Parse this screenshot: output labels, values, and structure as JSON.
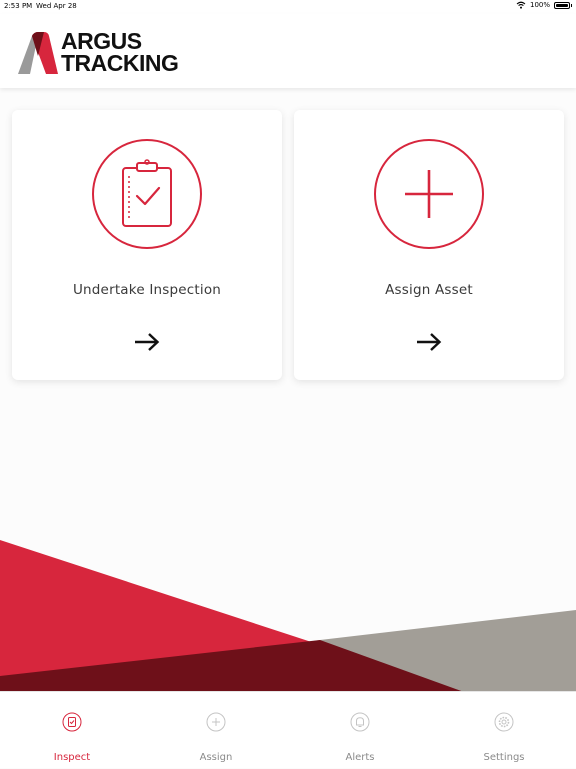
{
  "status_bar": {
    "time": "2:53 PM",
    "date": "Wed Apr 28",
    "battery": "100%"
  },
  "header": {
    "logo_line1": "ARGUS",
    "logo_line2": "TRACKING"
  },
  "cards": [
    {
      "label": "Undertake Inspection",
      "icon": "clipboard-check-icon",
      "arrow": "→"
    },
    {
      "label": "Assign Asset",
      "icon": "plus-icon",
      "arrow": "→"
    }
  ],
  "tabs": [
    {
      "label": "Inspect",
      "icon": "clipboard-icon",
      "active": true
    },
    {
      "label": "Assign",
      "icon": "plus-circle-icon",
      "active": false
    },
    {
      "label": "Alerts",
      "icon": "bell-icon",
      "active": false
    },
    {
      "label": "Settings",
      "icon": "gear-icon",
      "active": false
    }
  ],
  "colors": {
    "accent": "#d7263d",
    "dark_red": "#6e1019",
    "grey": "#a29e97",
    "inactive": "#8a8a8a"
  }
}
